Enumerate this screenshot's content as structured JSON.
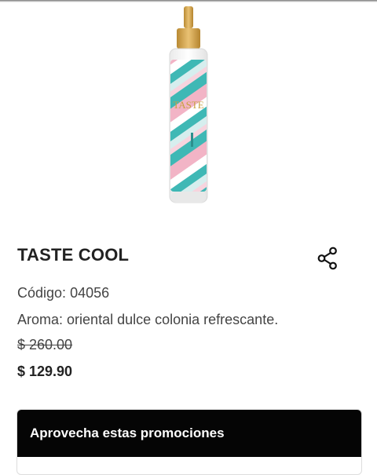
{
  "product": {
    "name": "TASTE COOL",
    "bottle_label": "TASTE",
    "code_label": "Código:",
    "code": "04056",
    "aroma_label": "Aroma:",
    "aroma": "oriental dulce colonia refrescante.",
    "old_price": "$ 260.00",
    "price": "$ 129.90"
  },
  "share": {
    "icon": "share-icon"
  },
  "promotions": {
    "title": "Aprovecha estas promociones"
  },
  "colors": {
    "cap": "#d9a84a",
    "teal": "#3fb8b5",
    "pink": "#f2b4c6",
    "promo_header_bg": "#050505"
  }
}
